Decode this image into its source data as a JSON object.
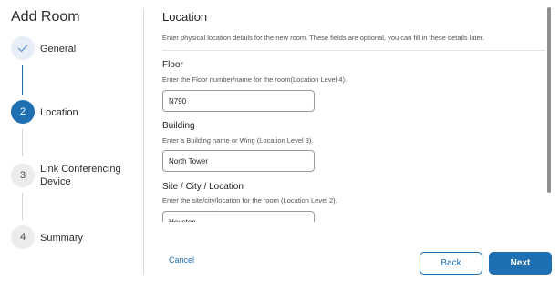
{
  "wizard": {
    "title": "Add Room"
  },
  "steps": [
    {
      "number": "",
      "label": "General",
      "state": "done"
    },
    {
      "number": "2",
      "label": "Location",
      "state": "active"
    },
    {
      "number": "3",
      "label": "Link Conferencing Device",
      "state": "todo"
    },
    {
      "number": "4",
      "label": "Summary",
      "state": "todo"
    }
  ],
  "section": {
    "title": "Location",
    "description": "Enter physical location details for the new room. These fields are optional, you can fill in these details later."
  },
  "fields": {
    "floor": {
      "label": "Floor",
      "help": "Enter the Floor number/name for the room(Location Level 4).",
      "value": "N790"
    },
    "building": {
      "label": "Building",
      "help": "Enter a Building name or Wing (Location Level 3).",
      "value": "North Tower"
    },
    "site": {
      "label": "Site / City / Location",
      "help": "Enter the site/city/location for the room (Location Level 2).",
      "value": "Houston"
    }
  },
  "footer": {
    "cancel_label": "Cancel",
    "back_label": "Back",
    "next_label": "Next"
  },
  "colors": {
    "accent": "#1f6fb3",
    "done_bg": "#e7eef8",
    "todo_bg": "#ececec"
  }
}
